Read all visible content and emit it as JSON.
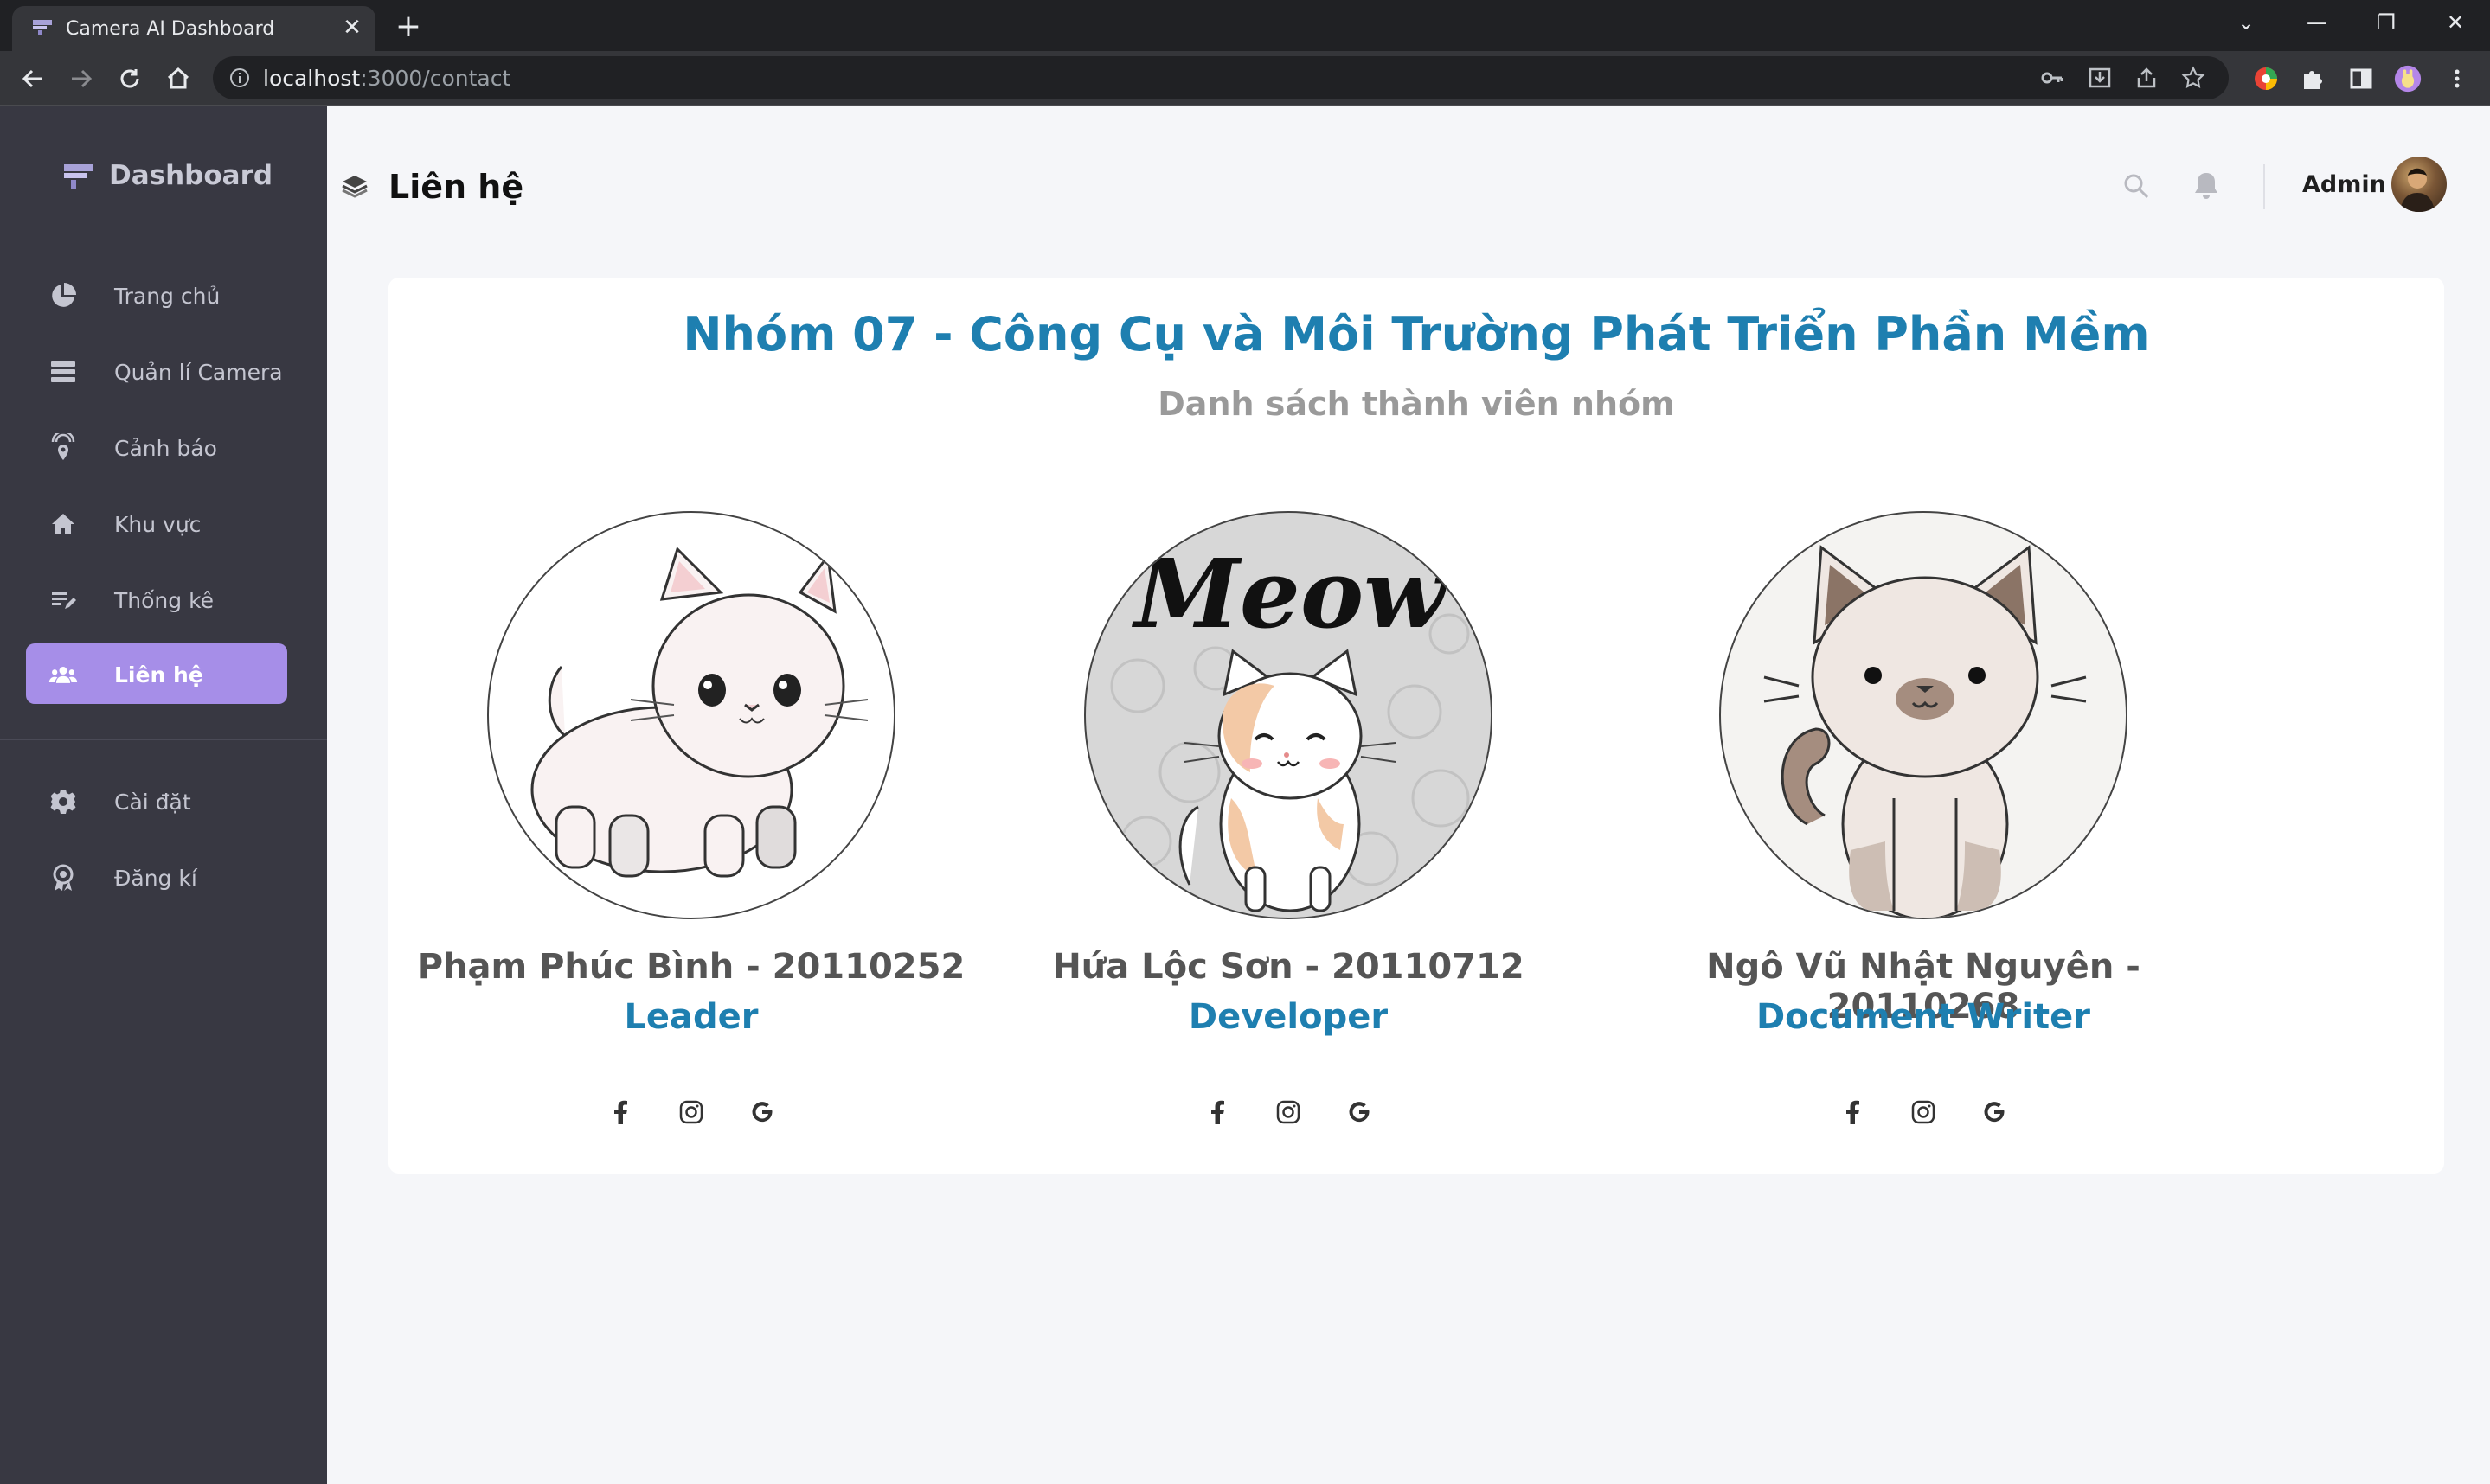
{
  "browser": {
    "tab_title": "Camera AI Dashboard",
    "tab_close": "✕",
    "new_tab": "+",
    "url_host": "localhost",
    "url_path": ":3000/contact"
  },
  "sidebar": {
    "brand": "Dashboard",
    "items": [
      {
        "label": "Trang chủ",
        "icon": "pie-chart-icon"
      },
      {
        "label": "Quản lí Camera",
        "icon": "server-list-icon"
      },
      {
        "label": "Cảnh báo",
        "icon": "location-signal-icon"
      },
      {
        "label": "Khu vực",
        "icon": "home-icon"
      },
      {
        "label": "Thống kê",
        "icon": "edit-list-icon"
      },
      {
        "label": "Liên hệ",
        "icon": "users-icon",
        "active": true
      }
    ],
    "bottom_items": [
      {
        "label": "Cài đặt",
        "icon": "gear-icon"
      },
      {
        "label": "Đăng kí",
        "icon": "award-icon"
      }
    ]
  },
  "header": {
    "title": "Liên hệ",
    "user": "Admin"
  },
  "content": {
    "title": "Nhóm 07 - Công Cụ và Môi Trường Phát Triển Phần Mềm",
    "subtitle": "Danh sách thành viên nhóm",
    "members": [
      {
        "name": "Phạm Phúc Bình - 20110252",
        "role": "Leader"
      },
      {
        "name": "Hứa Lộc Sơn - 20110712",
        "role": "Developer"
      },
      {
        "name": "Ngô Vũ Nhật Nguyên - 20110268",
        "role": "Document Writer"
      }
    ],
    "meow_text": "Meow"
  },
  "colors": {
    "sidebar_bg": "#383842",
    "active_item": "#a68ee8",
    "title_blue": "#1e7fb0"
  }
}
